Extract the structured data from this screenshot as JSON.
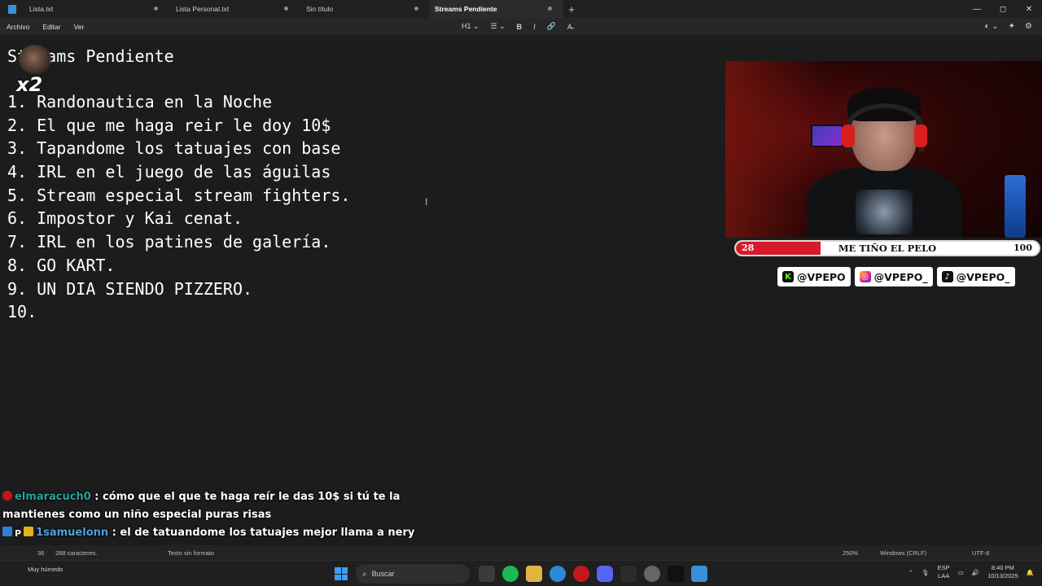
{
  "tabs": [
    {
      "label": "Lista.txt"
    },
    {
      "label": "Lista Personal.txt"
    },
    {
      "label": "Sin título"
    },
    {
      "label": "Streams Pendiente"
    }
  ],
  "new_tab": "+",
  "window_controls": {
    "minimize": "—",
    "maximize": "◻",
    "close": "✕"
  },
  "menu": {
    "archivo": "Archivo",
    "editar": "Editar",
    "ver": "Ver"
  },
  "format_tools": {
    "heading": "H1 ⌄",
    "list": "☰ ⌄",
    "bold": "B",
    "italic": "I",
    "link": "🔗",
    "clear": "A̶"
  },
  "document": {
    "title": "Streams Pendiente",
    "lines": [
      "1. Randonautica en la Noche",
      "2. El que me haga reir le doy 10$",
      "3. Tapandome los tatuajes con base",
      "4. IRL en el juego de las águilas",
      "5. Stream especial stream fighters.",
      "6. Impostor y Kai cenat.",
      "7. IRL en los patines de galería.",
      "8. GO KART.",
      "9. UN DIA SIENDO PIZZERO.",
      "10."
    ]
  },
  "overlay": {
    "multiplier": "x2",
    "goal": {
      "start": "28",
      "label": "ME TIÑO EL PELO",
      "end": "100",
      "progress_fraction": 0.28
    },
    "socials": [
      {
        "platform": "kick-icon",
        "handle": "@VPEPO",
        "glyph": "K"
      },
      {
        "platform": "instagram-icon",
        "handle": "@VPEPO_",
        "glyph": "◎"
      },
      {
        "platform": "tiktok-icon",
        "handle": "@VPEPO_",
        "glyph": "♪"
      }
    ]
  },
  "chat": [
    {
      "user": "elmaracuch0",
      "message": ": cómo que el que te haga reír le das 10$ si tú te la mantienes como un niño especial puras risas"
    },
    {
      "user": "1samuelonn",
      "message": ": el de tatuandome los tatuajes mejor llama a nery q te ayude"
    },
    {
      "user": "1samuelonn",
      "message": ":"
    }
  ],
  "statusbar": {
    "line_col": "36",
    "chars": "288 caracteres.",
    "format": "Texto sin formato",
    "zoom": "250%",
    "eol": "Windows (CRLF)",
    "encoding": "UTF-8"
  },
  "taskbar": {
    "weather": "Muy húmedo",
    "search": "Buscar",
    "lang_top": "ESP",
    "lang_bottom": "LAA",
    "time": "8:40 PM",
    "date": "10/13/2025"
  },
  "colors": {
    "accent_red": "#d7192a",
    "spell_underline": "#d13438",
    "editor_bg": "#1c1c1c"
  }
}
